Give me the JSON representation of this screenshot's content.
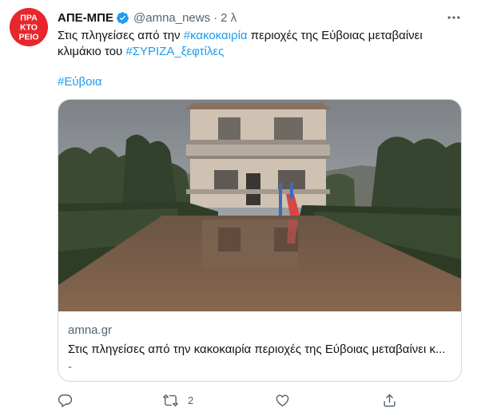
{
  "account": {
    "avatar_text": [
      "ΠΡΑ",
      "ΚΤΟ",
      "ΡΕΙΟ"
    ],
    "name": "ΑΠΕ-ΜΠΕ",
    "handle": "@amna_news",
    "separator": "·",
    "time": "2 λ",
    "verified_icon": "verified-badge-icon",
    "avatar_color": "#e8262c"
  },
  "tweet": {
    "line1_before": "Στις πληγείσες από την ",
    "line1_tag": "#κακοκαιρία",
    "line1_after": " περιοχές της Εύβοιας μεταβαίνει",
    "line2_before": "κλιμάκιο του ",
    "line2_tag": "#ΣΥΡΙΖΑ_ξεφτίλες",
    "hashtag_line": "#Εύβοια",
    "link_color": "#1d9bf0"
  },
  "card": {
    "image_icon": "flooded-house-photo",
    "domain": "amna.gr",
    "title": "Στις πληγείσες από την κακοκαιρία περιοχές της Εύβοιας μεταβαίνει κ...",
    "description": "-"
  },
  "actions": {
    "reply_icon": "reply-icon",
    "retweet_icon": "retweet-icon",
    "retweet_count": "2",
    "like_icon": "heart-icon",
    "share_icon": "share-icon",
    "more_icon": "more-dots-icon"
  }
}
